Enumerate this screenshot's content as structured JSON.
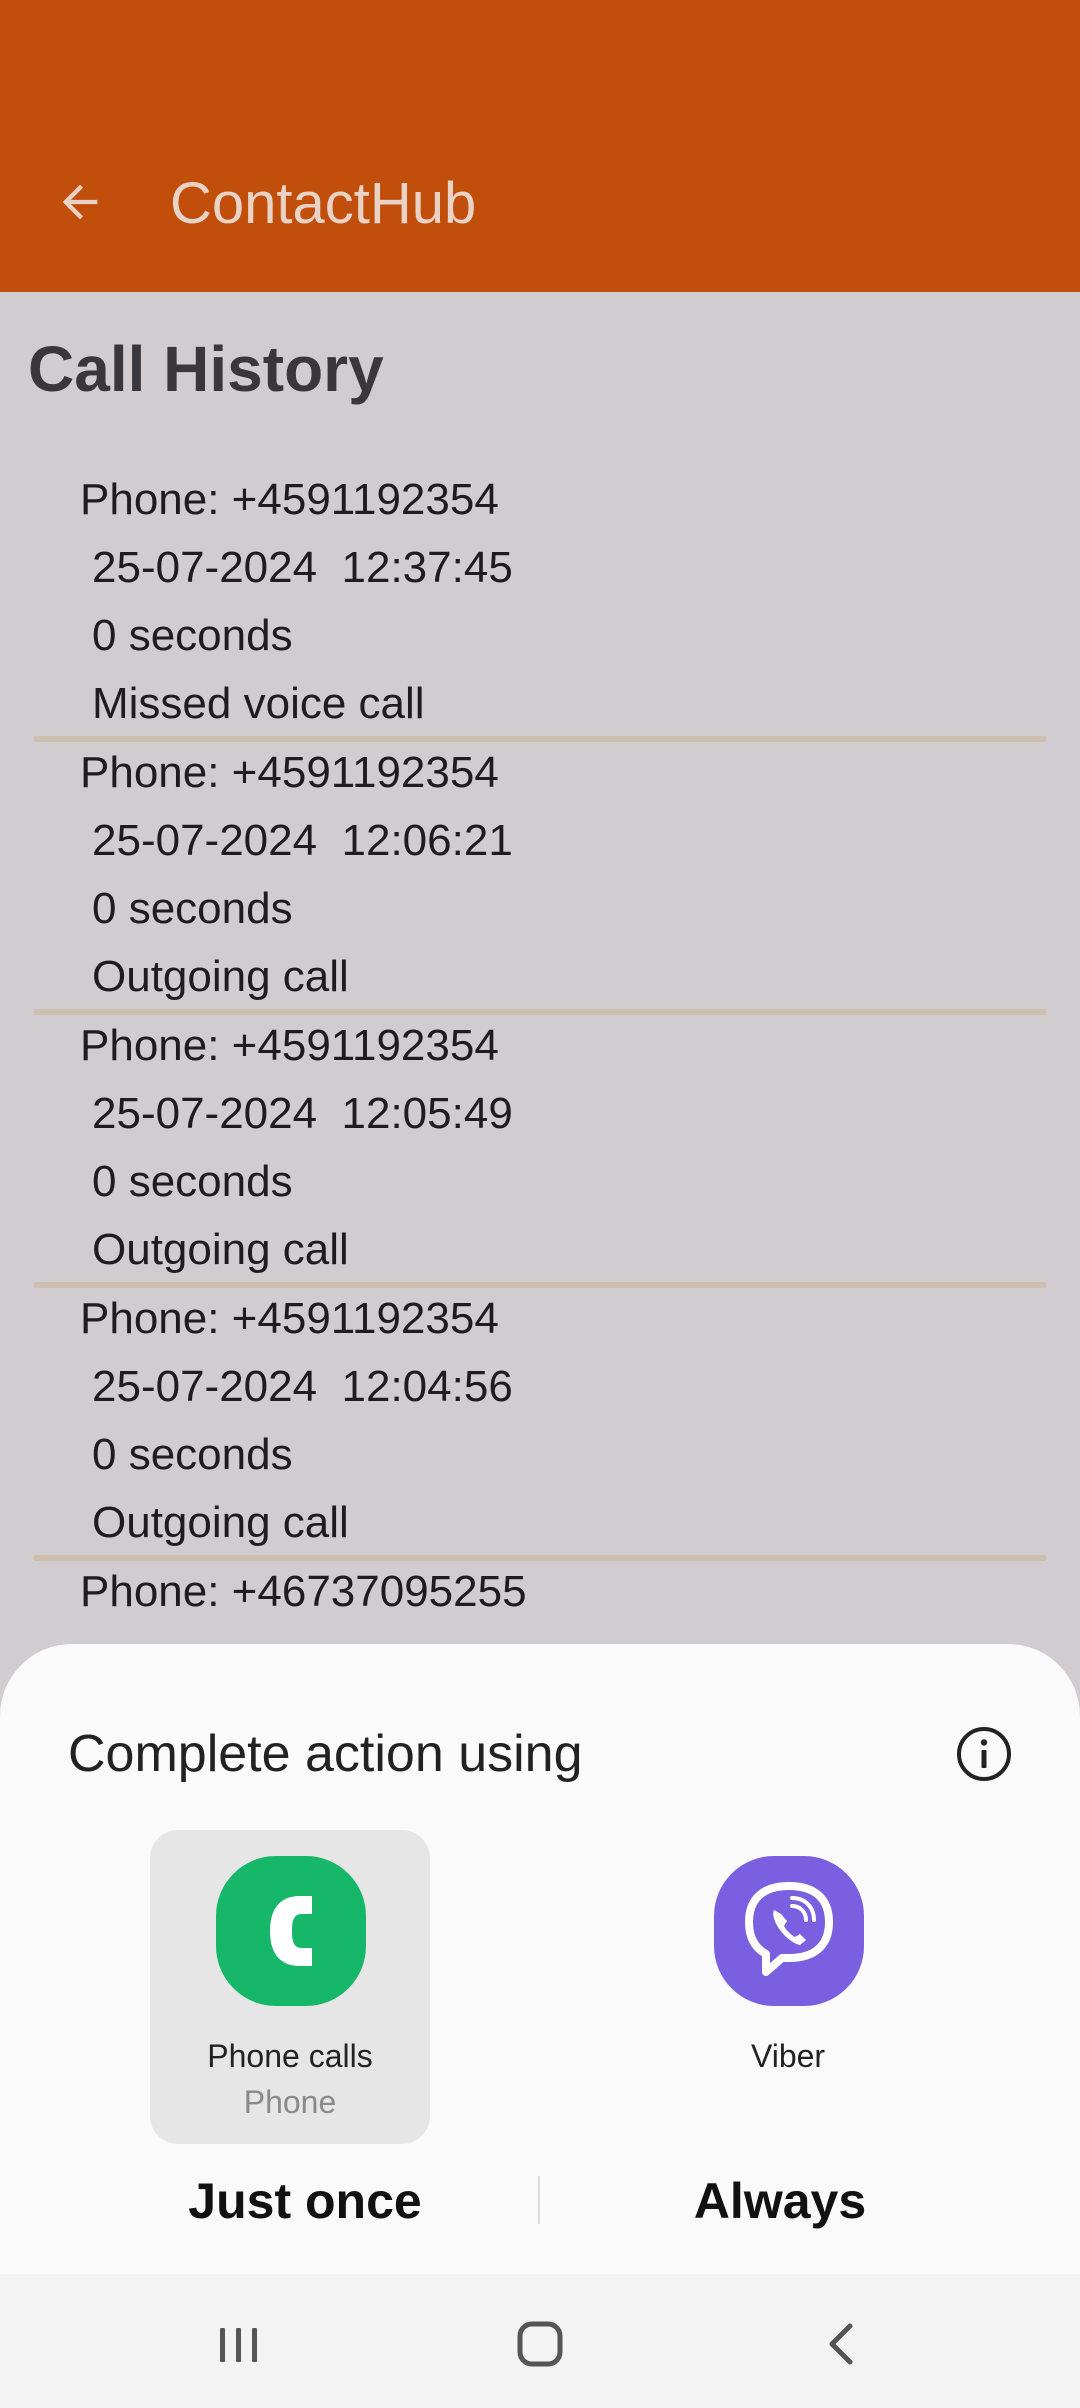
{
  "app_bar": {
    "title": "ContactHub",
    "back_icon": "arrow-left-icon",
    "color": "#c24e0c"
  },
  "page": {
    "title": "Call History"
  },
  "calls": [
    {
      "phone": "Phone: +4591192354",
      "datetime": "25-07-2024  12:37:45",
      "duration": "0 seconds",
      "type": "Missed voice call"
    },
    {
      "phone": "Phone: +4591192354",
      "datetime": "25-07-2024  12:06:21",
      "duration": "0 seconds",
      "type": "Outgoing call"
    },
    {
      "phone": "Phone: +4591192354",
      "datetime": "25-07-2024  12:05:49",
      "duration": "0 seconds",
      "type": "Outgoing call"
    },
    {
      "phone": "Phone: +4591192354",
      "datetime": "25-07-2024  12:04:56",
      "duration": "0 seconds",
      "type": "Outgoing call"
    },
    {
      "phone": "Phone: +46737095255"
    }
  ],
  "chooser": {
    "title": "Complete action using",
    "info_icon": "info-icon",
    "apps": [
      {
        "name": "Phone calls",
        "sub": "Phone",
        "icon": "phone-app-icon",
        "color": "#17b76a",
        "selected": true
      },
      {
        "name": "Viber",
        "icon": "viber-icon",
        "color": "#7a60e0",
        "selected": false
      }
    ],
    "just_once": "Just once",
    "always": "Always"
  },
  "nav_bar": {
    "recents_icon": "recents-icon",
    "home_icon": "home-icon",
    "back_icon": "back-icon"
  }
}
